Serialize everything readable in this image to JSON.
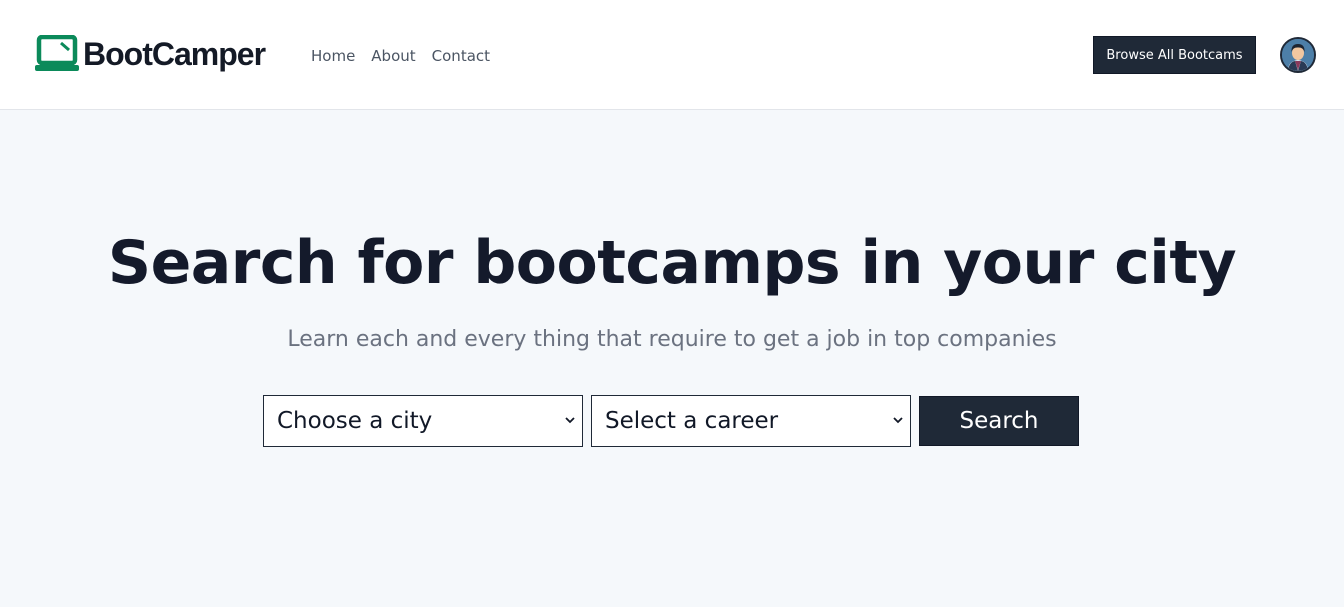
{
  "brand": {
    "name": "BootCamper",
    "icon": "laptop-icon",
    "color": "#0b8a5a"
  },
  "nav": {
    "links": [
      {
        "label": "Home"
      },
      {
        "label": "About"
      },
      {
        "label": "Contact"
      }
    ],
    "browse_button": "Browse All Bootcams",
    "avatar": "user-avatar"
  },
  "hero": {
    "title": "Search for bootcamps in your city",
    "subtitle": "Learn each and every thing that require to get a job in top companies"
  },
  "search": {
    "city_select": {
      "selected": "Choose a city",
      "icon": "chevron-down-icon"
    },
    "career_select": {
      "selected": "Select a career",
      "icon": "chevron-down-icon"
    },
    "button_label": "Search"
  },
  "colors": {
    "primary_dark": "#1f2937",
    "brand_green": "#0b8a5a",
    "page_bg": "#f5f8fb",
    "heading": "#141a2b",
    "muted_text": "#6b7280"
  }
}
